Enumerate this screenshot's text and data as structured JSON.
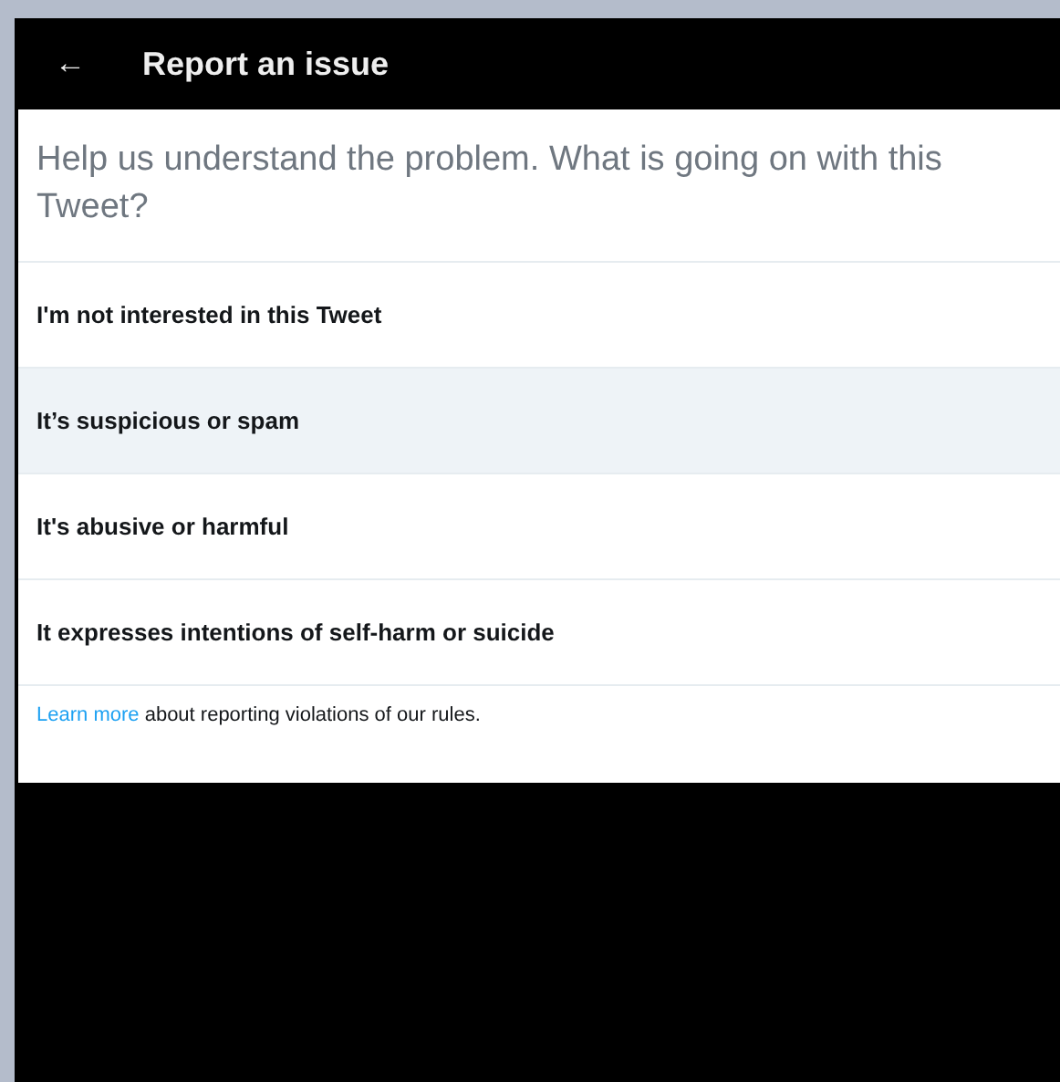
{
  "header": {
    "back": "←",
    "title": "Report an issue"
  },
  "prompt": "Help us understand the problem. What is going on with this Tweet?",
  "options": [
    {
      "label": "I'm not interested in this Tweet",
      "selected": false
    },
    {
      "label": "It’s suspicious or spam",
      "selected": true
    },
    {
      "label": "It's abusive or harmful",
      "selected": false
    },
    {
      "label": "It expresses intentions of self-harm or suicide",
      "selected": false
    }
  ],
  "footer": {
    "link": "Learn more",
    "text": "about reporting violations of our rules."
  }
}
